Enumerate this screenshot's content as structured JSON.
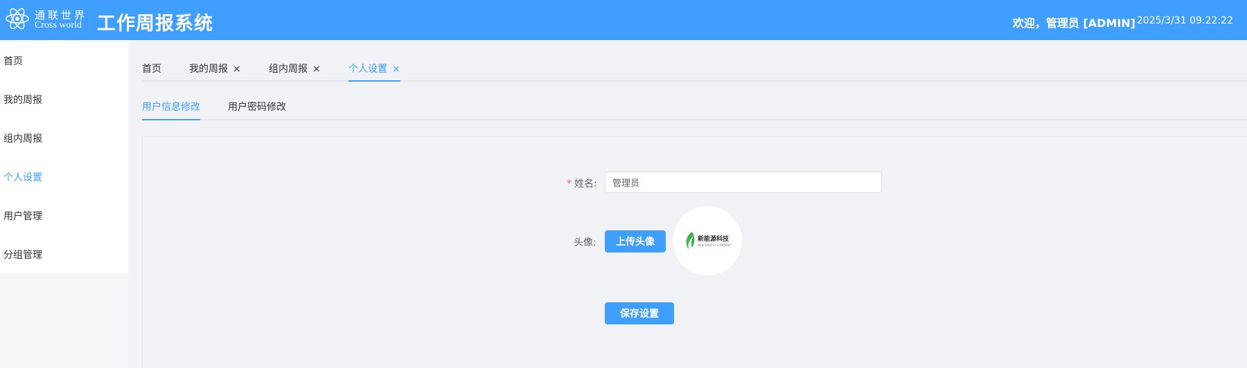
{
  "header": {
    "brand_cn": "通联世界",
    "brand_en": "Cross world",
    "title": "工作周报系统",
    "welcome": "欢迎，管理员 [ADMIN]",
    "datetime": "2025/3/31 09:22:22"
  },
  "sidebar": {
    "items": [
      {
        "label": "首页"
      },
      {
        "label": "我的周报"
      },
      {
        "label": "组内周报"
      },
      {
        "label": "个人设置",
        "active": true
      },
      {
        "label": "用户管理"
      },
      {
        "label": "分组管理"
      }
    ]
  },
  "tabs": [
    {
      "label": "首页"
    },
    {
      "label": "我的周报",
      "close": "×"
    },
    {
      "label": "组内周报",
      "close": "×"
    },
    {
      "label": "个人设置",
      "close": "×",
      "active": true
    }
  ],
  "subtabs": [
    {
      "label": "用户信息修改",
      "active": true
    },
    {
      "label": "用户密码修改"
    }
  ],
  "form": {
    "required_mark": "*",
    "name_label": "姓名:",
    "name_value": "管理员",
    "avatar_label": "头像:",
    "upload_button": "上传头像",
    "save_button": "保存设置"
  },
  "avatar": {
    "logo_text": "新能源科技",
    "logo_subtext": "NEW ENERGY COMPANY"
  },
  "colors": {
    "primary": "#409eff",
    "required": "#f56c6c",
    "logo_green": "#3cb44b"
  },
  "icons": {
    "logo": "atom-icon",
    "close": "close-icon",
    "avatar_logo": "leaf-icon"
  }
}
